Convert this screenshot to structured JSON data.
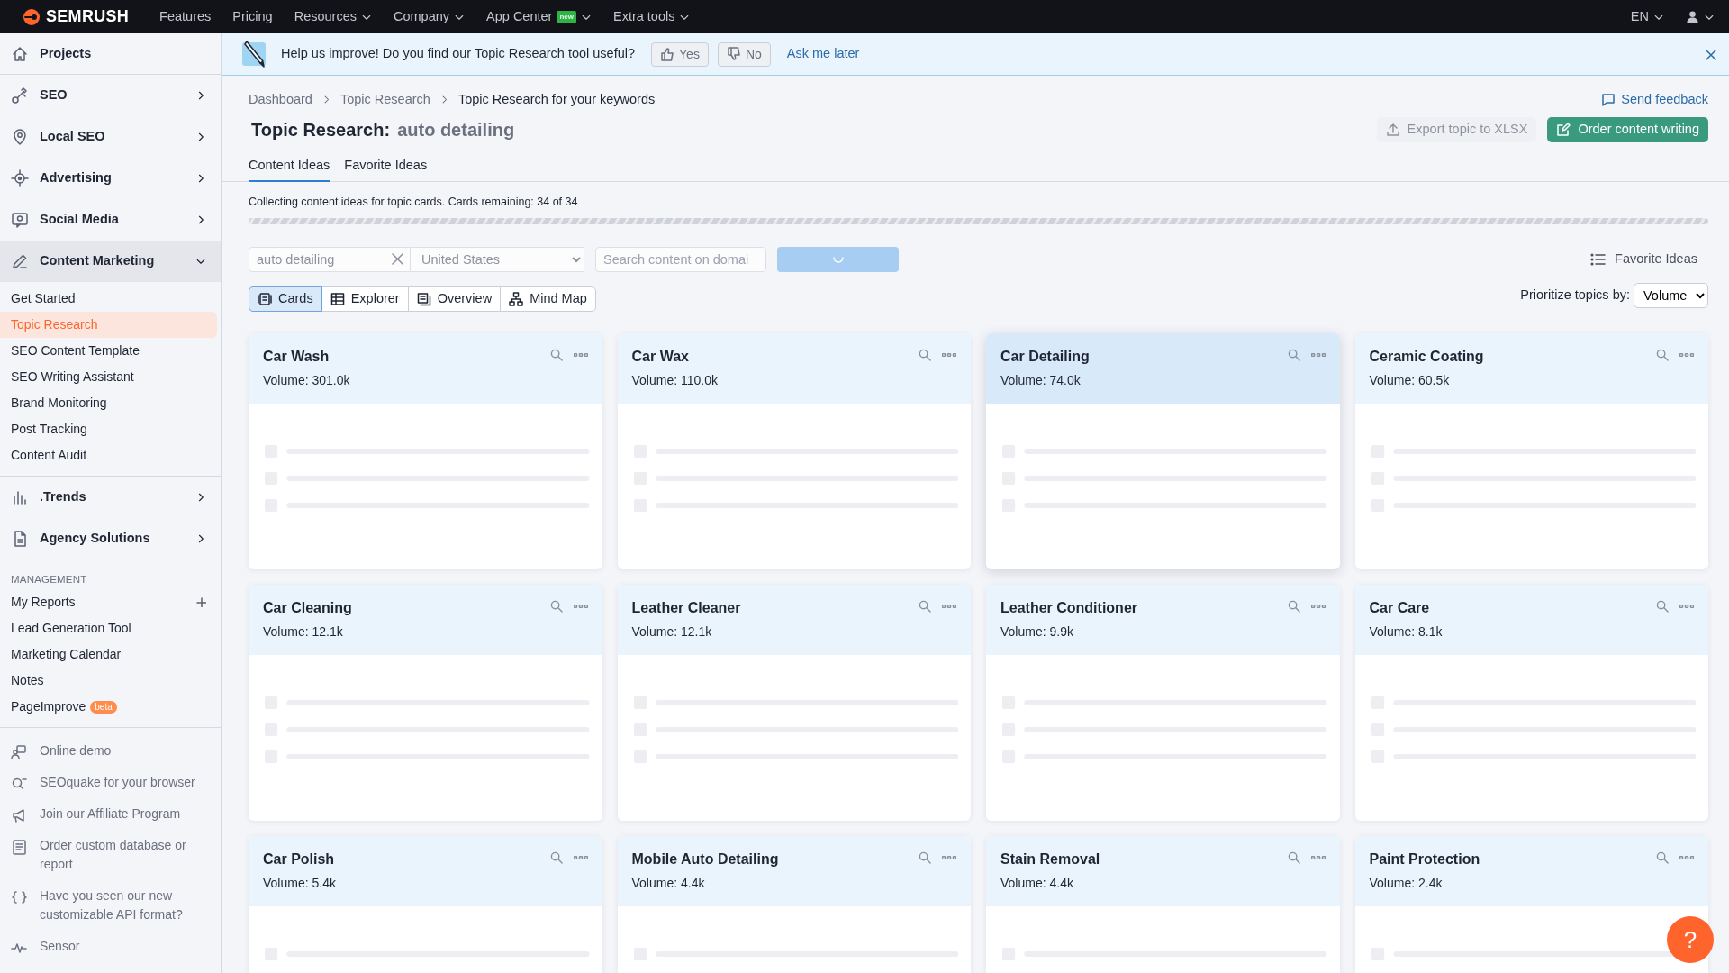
{
  "top_nav": {
    "logo": "SEMRUSH",
    "items": [
      {
        "label": "Features",
        "dropdown": false
      },
      {
        "label": "Pricing",
        "dropdown": false
      },
      {
        "label": "Resources",
        "dropdown": true
      },
      {
        "label": "Company",
        "dropdown": true
      },
      {
        "label": "App Center",
        "badge": "new",
        "dropdown": true
      },
      {
        "label": "Extra tools",
        "dropdown": true
      }
    ],
    "language": "EN"
  },
  "sidebar": {
    "main": [
      {
        "kind": "link",
        "label": "Projects"
      },
      {
        "kind": "group",
        "label": "SEO",
        "expanded": false
      },
      {
        "kind": "group",
        "label": "Local SEO",
        "expanded": false
      },
      {
        "kind": "group",
        "label": "Advertising",
        "expanded": false
      },
      {
        "kind": "group",
        "label": "Social Media",
        "expanded": false
      },
      {
        "kind": "group",
        "label": "Content Marketing",
        "expanded": true,
        "children": [
          {
            "label": "Get Started",
            "selected": false
          },
          {
            "label": "Topic Research",
            "selected": true
          },
          {
            "label": "SEO Content Template",
            "selected": false
          },
          {
            "label": "SEO Writing Assistant",
            "selected": false
          },
          {
            "label": "Brand Monitoring",
            "selected": false
          },
          {
            "label": "Post Tracking",
            "selected": false
          },
          {
            "label": "Content Audit",
            "selected": false
          }
        ]
      },
      {
        "kind": "group",
        "label": ".Trends",
        "expanded": false
      },
      {
        "kind": "group",
        "label": "Agency Solutions",
        "expanded": false
      }
    ],
    "management": {
      "heading": "MANAGEMENT",
      "items": [
        {
          "label": "My Reports",
          "can_add": true
        },
        {
          "label": "Lead Generation Tool",
          "can_add": false
        },
        {
          "label": "Marketing Calendar",
          "can_add": false
        },
        {
          "label": "Notes",
          "can_add": false
        },
        {
          "label": "PageImprove",
          "can_add": false,
          "badge": "beta"
        }
      ]
    },
    "footer_links": [
      "Online demo",
      "SEOquake for your browser",
      "Join our Affiliate Program",
      "Order custom database or report",
      "Have you seen our new customizable API format?",
      "Sensor"
    ]
  },
  "banner": {
    "text": "Help us improve! Do you find our Topic Research tool useful?",
    "yes": "Yes",
    "no": "No",
    "later": "Ask me later"
  },
  "breadcrumbs": [
    "Dashboard",
    "Topic Research",
    "Topic Research for your keywords"
  ],
  "send_feedback": "Send feedback",
  "title": {
    "label": "Topic Research:",
    "keyword": "auto detailing"
  },
  "actions": [
    {
      "label": "Export topic to XLSX",
      "disabled": true
    },
    {
      "label": "Order content writing",
      "disabled": false
    }
  ],
  "tabs": [
    {
      "label": "Content Ideas",
      "selected": true
    },
    {
      "label": "Favorite Ideas",
      "selected": false
    }
  ],
  "progress_text": "Collecting content ideas for topic cards. Cards remaining: 34 of 34",
  "search": {
    "disabled": true,
    "keyword": "auto detailing",
    "country": "United States",
    "domain_placeholder": "Search content on domai",
    "loading": true
  },
  "favorite_link": "Favorite Ideas",
  "views": [
    {
      "label": "Cards",
      "selected": true
    },
    {
      "label": "Explorer",
      "selected": false
    },
    {
      "label": "Overview",
      "selected": false
    },
    {
      "label": "Mind Map",
      "selected": false
    }
  ],
  "prioritize": {
    "label": "Prioritize topics by:",
    "value": "Volume"
  },
  "cards": [
    {
      "title": "Car Wash",
      "volume": "Volume: 301.0k",
      "highlighted": false
    },
    {
      "title": "Car Wax",
      "volume": "Volume: 110.0k",
      "highlighted": false
    },
    {
      "title": "Car Detailing",
      "volume": "Volume: 74.0k",
      "highlighted": true
    },
    {
      "title": "Ceramic Coating",
      "volume": "Volume: 60.5k",
      "highlighted": false
    },
    {
      "title": "Car Cleaning",
      "volume": "Volume: 12.1k",
      "highlighted": false
    },
    {
      "title": "Leather Cleaner",
      "volume": "Volume: 12.1k",
      "highlighted": false
    },
    {
      "title": "Leather Conditioner",
      "volume": "Volume: 9.9k",
      "highlighted": false
    },
    {
      "title": "Car Care",
      "volume": "Volume: 8.1k",
      "highlighted": false
    },
    {
      "title": "Car Polish",
      "volume": "Volume: 5.4k",
      "highlighted": false
    },
    {
      "title": "Mobile Auto Detailing",
      "volume": "Volume: 4.4k",
      "highlighted": false
    },
    {
      "title": "Stain Removal",
      "volume": "Volume: 4.4k",
      "highlighted": false
    },
    {
      "title": "Paint Protection",
      "volume": "Volume: 2.4k",
      "highlighted": false
    }
  ],
  "help": "?"
}
